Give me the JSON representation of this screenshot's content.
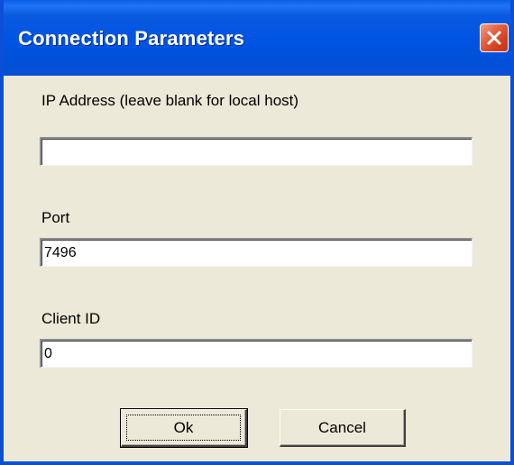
{
  "window": {
    "title": "Connection Parameters"
  },
  "form": {
    "ip_label": "IP Address (leave blank for local host)",
    "ip_value": "",
    "port_label": "Port",
    "port_value": "7496",
    "client_id_label": "Client ID",
    "client_id_value": "0"
  },
  "buttons": {
    "ok_label": "Ok",
    "cancel_label": "Cancel"
  },
  "icons": {
    "close": "close-icon"
  },
  "colors": {
    "titlebar": "#0054e3",
    "close_button": "#d4401f",
    "dialog_background": "#ece9d8"
  }
}
